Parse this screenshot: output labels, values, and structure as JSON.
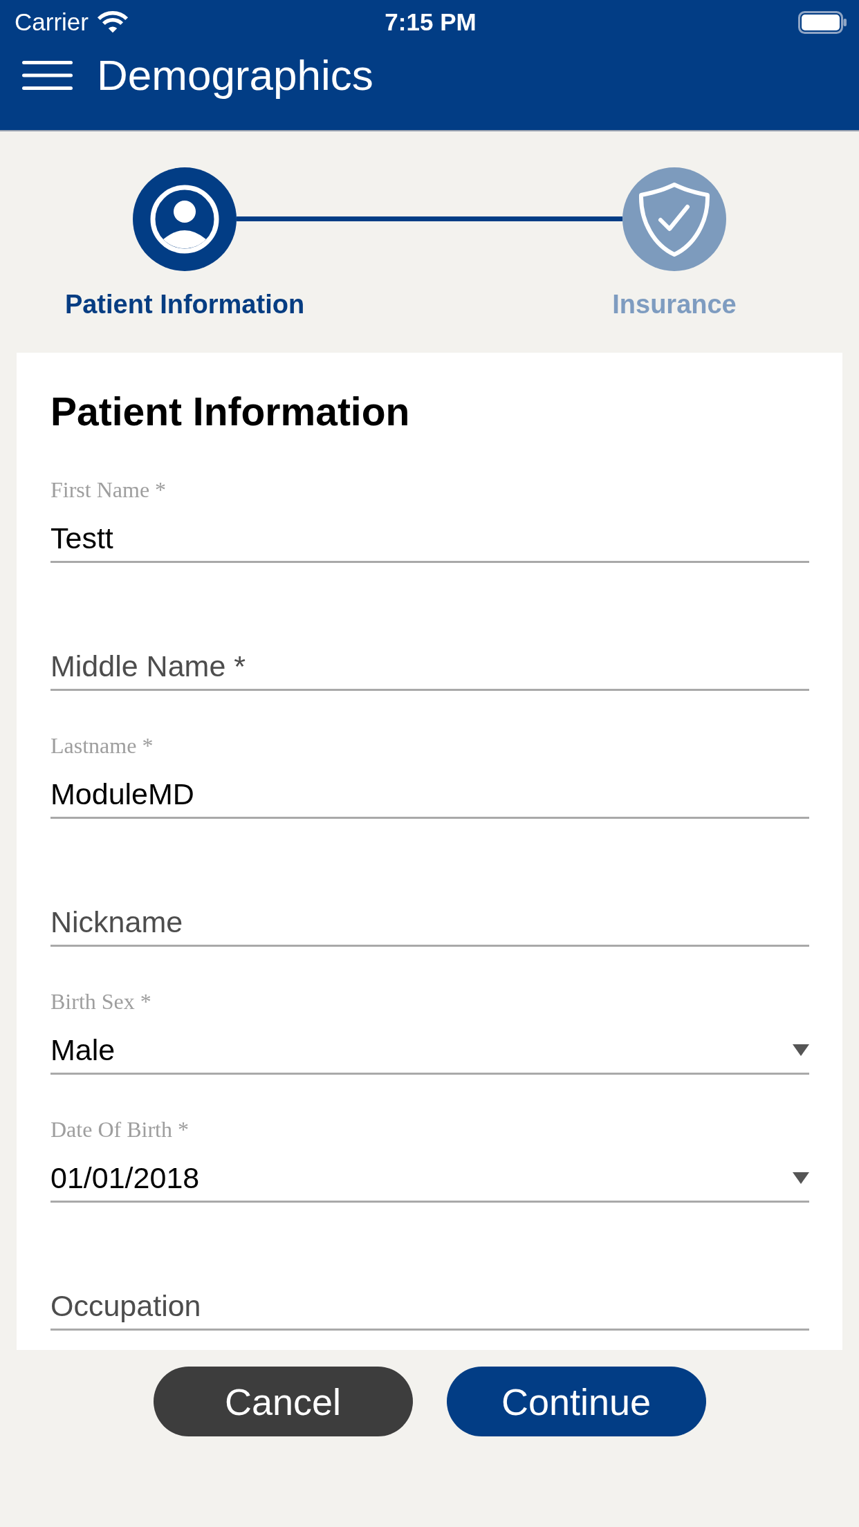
{
  "status_bar": {
    "carrier": "Carrier",
    "time": "7:15 PM"
  },
  "header": {
    "title": "Demographics"
  },
  "stepper": {
    "steps": [
      {
        "kind": "person",
        "label": "Patient Information",
        "selected": true
      },
      {
        "kind": "shield",
        "label": "Insurance",
        "selected": false
      }
    ]
  },
  "form": {
    "title": "Patient Information",
    "fields": [
      {
        "kind": "text",
        "label": "First Name *",
        "value": "Testt"
      },
      {
        "kind": "text",
        "placeholder": "Middle Name *"
      },
      {
        "kind": "text",
        "label": "Lastname *",
        "value": "ModuleMD"
      },
      {
        "kind": "text",
        "placeholder": "Nickname"
      },
      {
        "kind": "dropdown",
        "label": "Birth Sex *",
        "value": "Male"
      },
      {
        "kind": "dropdown",
        "label": "Date Of Birth *",
        "value": "01/01/2018"
      },
      {
        "kind": "text",
        "placeholder": "Occupation"
      }
    ]
  },
  "buttons": [
    {
      "kind": "secondary",
      "label": "Cancel"
    },
    {
      "kind": "primary",
      "label": "Continue"
    }
  ]
}
